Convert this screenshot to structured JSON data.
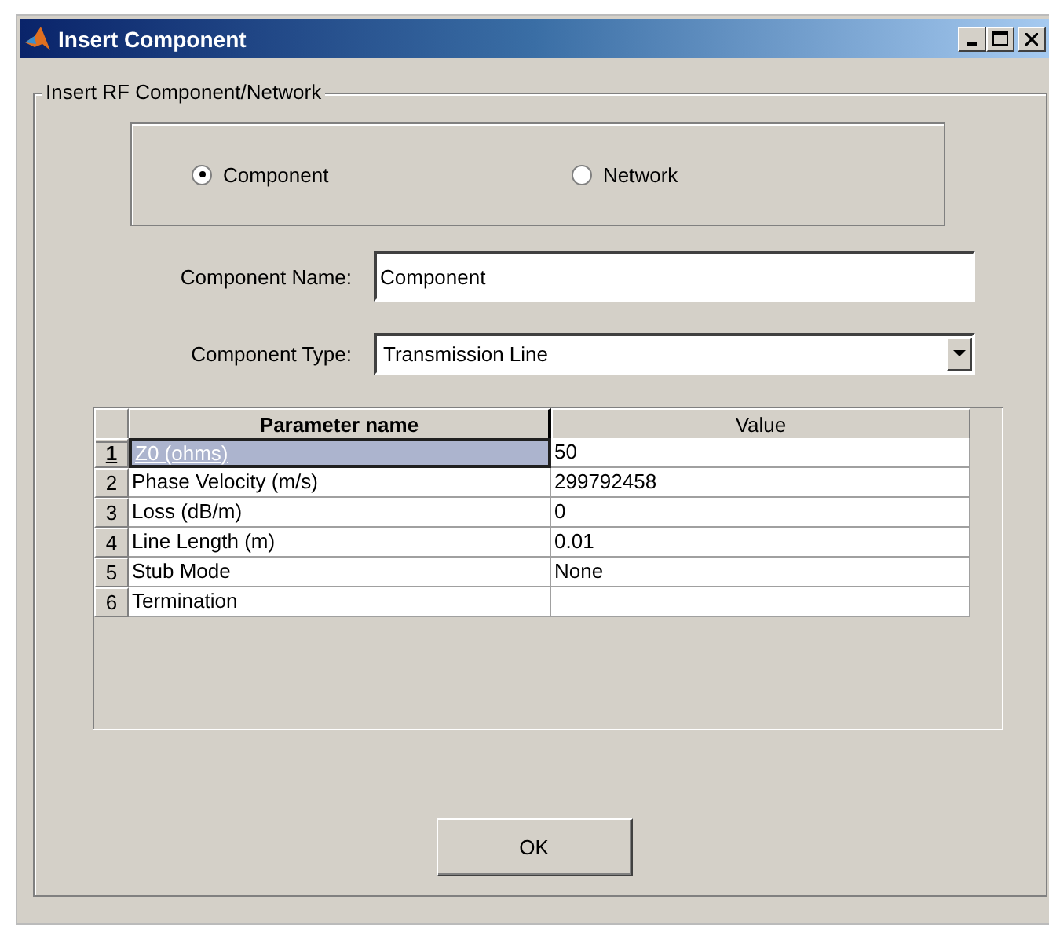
{
  "window": {
    "title": "Insert Component"
  },
  "group": {
    "title": "Insert RF Component/Network"
  },
  "mode_options": [
    {
      "label": "Component",
      "selected": true
    },
    {
      "label": "Network",
      "selected": false
    }
  ],
  "component_name": {
    "label": "Component Name:",
    "value": "Component"
  },
  "component_type": {
    "label": "Component Type:",
    "value": "Transmission Line"
  },
  "table": {
    "columns": [
      {
        "label": "Parameter name",
        "selected": true
      },
      {
        "label": "Value",
        "selected": false
      }
    ],
    "rows": [
      {
        "number": "1",
        "name": "Z0 (ohms)",
        "value": "50",
        "selected": true
      },
      {
        "number": "2",
        "name": "Phase Velocity (m/s)",
        "value": "299792458",
        "selected": false
      },
      {
        "number": "3",
        "name": "Loss (dB/m)",
        "value": "0",
        "selected": false
      },
      {
        "number": "4",
        "name": "Line Length (m)",
        "value": "0.01",
        "selected": false
      },
      {
        "number": "5",
        "name": "Stub Mode",
        "value": "None",
        "selected": false
      },
      {
        "number": "6",
        "name": "Termination",
        "value": "",
        "selected": false
      }
    ]
  },
  "buttons": [
    "OK"
  ]
}
